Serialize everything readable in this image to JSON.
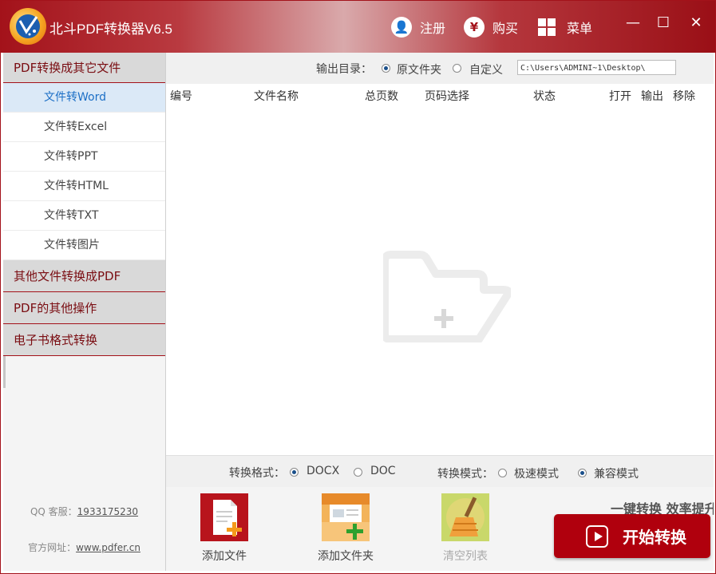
{
  "app": {
    "title": "北斗PDF转换器V6.5"
  },
  "titlebar": {
    "register_label": "注册",
    "buy_label": "购买",
    "buy_symbol": "¥",
    "menu_label": "菜单",
    "minimize": "—",
    "maximize": "☐",
    "close": "✕"
  },
  "sidebar": {
    "categories": [
      {
        "label": "PDF转换成其它文件"
      },
      {
        "label": "其他文件转换成PDF"
      },
      {
        "label": "PDF的其他操作"
      },
      {
        "label": "电子书格式转换"
      }
    ],
    "items": [
      {
        "label": "文件转Word"
      },
      {
        "label": "文件转Excel"
      },
      {
        "label": "文件转PPT"
      },
      {
        "label": "文件转HTML"
      },
      {
        "label": "文件转TXT"
      },
      {
        "label": "文件转图片"
      }
    ],
    "qq_label": "QQ 客服：",
    "qq_number": "1933175230",
    "site_label": "官方网址：",
    "site_url": "www.pdfer.cn"
  },
  "output": {
    "label": "输出目录：",
    "option_source": "原文件夹",
    "option_custom": "自定义",
    "path": "C:\\Users\\ADMINI~1\\Desktop\\"
  },
  "table": {
    "columns": [
      "编号",
      "文件名称",
      "总页数",
      "页码选择",
      "状态",
      "打开",
      "输出",
      "移除"
    ]
  },
  "format": {
    "label": "转换格式：",
    "docx": "DOCX",
    "doc": "DOC",
    "mode_label": "转换模式：",
    "mode_fast": "极速模式",
    "mode_compat": "兼容模式"
  },
  "toolbar": {
    "add_file": "添加文件",
    "add_folder": "添加文件夹",
    "clear_list": "清空列表",
    "tagline": "一键转换  效率提升",
    "start_label": "开始转换"
  },
  "colors": {
    "brand": "#a3121a",
    "active_item": "#1c6fc6",
    "start_button": "#b0000d"
  }
}
